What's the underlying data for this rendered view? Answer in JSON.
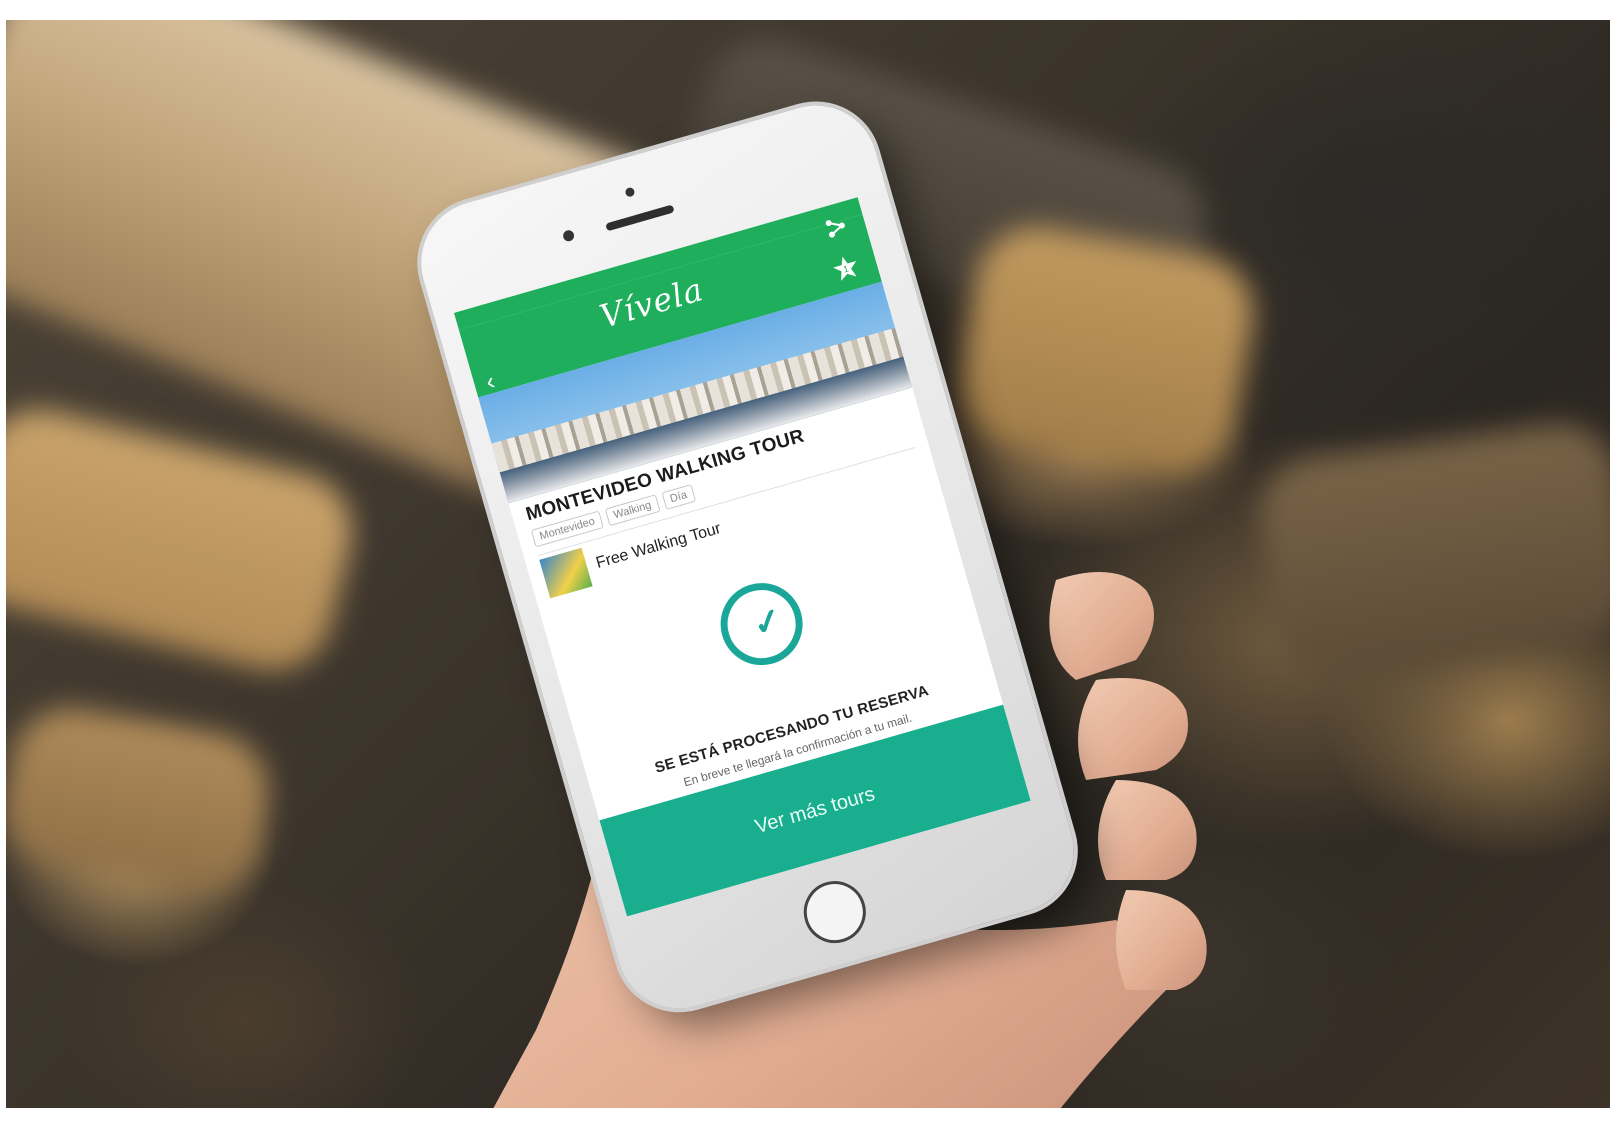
{
  "app": {
    "logo": "Vívela"
  },
  "tour": {
    "title": "MONTEVIDEO WALKING TOUR",
    "tags": [
      "Montevideo",
      "Walking",
      "Día"
    ],
    "operator": "Free Walking Tour",
    "favorites_count": "1"
  },
  "confirmation": {
    "title": "SE ESTÁ PROCESANDO TU RESERVA",
    "subtitle": "En breve te llegará la confirmación a tu mail."
  },
  "cta": {
    "label": "Ver más tours"
  },
  "colors": {
    "header_green": "#1fae5c",
    "accent_teal": "#1aa79a",
    "button_teal": "#19ae8e"
  },
  "icons": [
    "back-arrow-icon",
    "share-icon",
    "star-badge-icon",
    "check-circle-icon"
  ]
}
